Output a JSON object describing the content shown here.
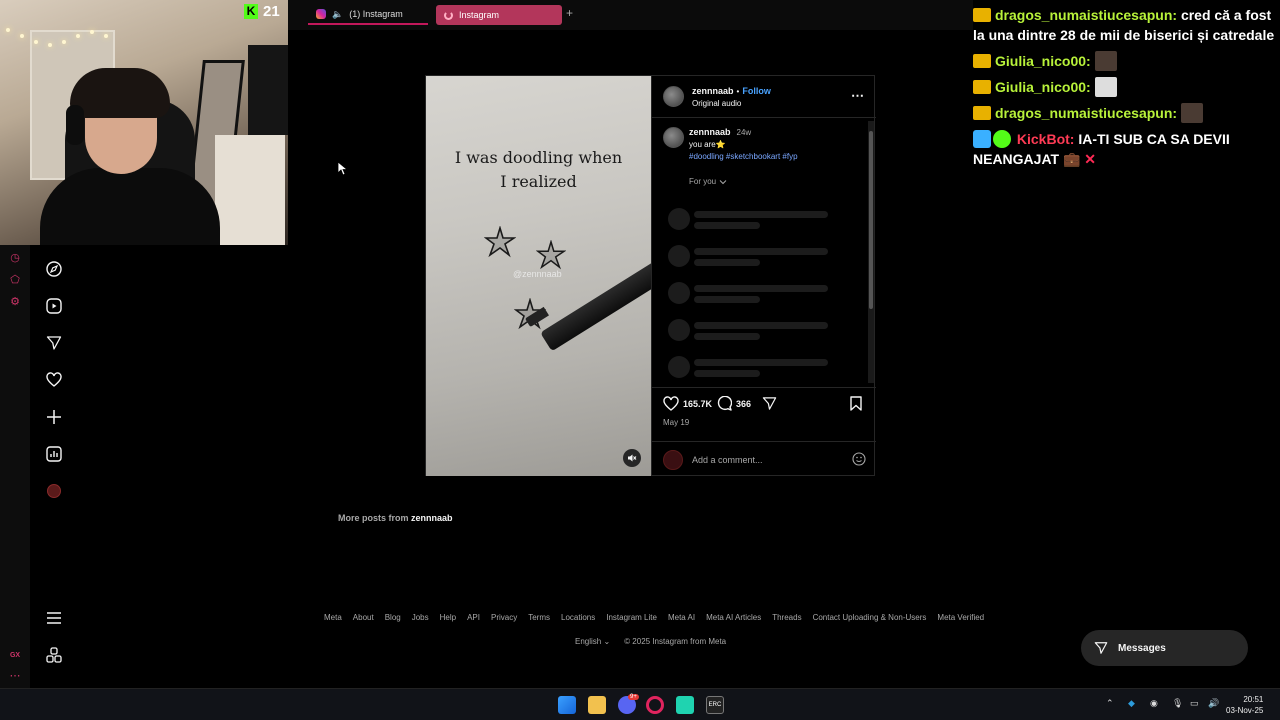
{
  "stream": {
    "kick_viewers": "21"
  },
  "browser": {
    "tabs": [
      {
        "label": "(1) Instagram"
      },
      {
        "label": "Instagram"
      }
    ],
    "new_tab": "+"
  },
  "post": {
    "author": "zennnaab",
    "follow_label": "Follow",
    "separator": "•",
    "audio": "Original audio",
    "more_label": "⋯",
    "media_text_line1": "I was doodling when",
    "media_text_line2": "I realized",
    "watermark": "@zennnaab",
    "caption": {
      "author": "zennnaab",
      "age": "24w",
      "text": "you are⭐",
      "hashtags": "#doodling #sketchbookart #fyp"
    },
    "sort_label": "For you",
    "likes": "165.7K",
    "comments": "366",
    "date": "May 19",
    "add_comment_placeholder": "Add a comment..."
  },
  "more_posts": {
    "prefix": "More posts from",
    "user": "zennnaab"
  },
  "footer": {
    "links": [
      "Meta",
      "About",
      "Blog",
      "Jobs",
      "Help",
      "API",
      "Privacy",
      "Terms",
      "Locations",
      "Instagram Lite",
      "Meta AI",
      "Meta AI Articles",
      "Threads",
      "Contact Uploading & Non-Users",
      "Meta Verified"
    ],
    "language": "English",
    "copyright": "© 2025 Instagram from Meta"
  },
  "messages_label": "Messages",
  "chat": [
    {
      "user": "dragos_numaistiucesapun:",
      "text": "cred că a fost la una dintre 28 de mii de biserici și catredale"
    },
    {
      "user": "Giulia_nico00:",
      "text": ""
    },
    {
      "user": "Giulia_nico00:",
      "text": ""
    },
    {
      "user": "dragos_numaistiucesapun:",
      "text": ""
    },
    {
      "user": "KickBot:",
      "text": "IA-TI SUB CA SA DEVII NEANGAJAT"
    }
  ],
  "taskbar": {
    "time": "20:51",
    "date": "03-Nov-25",
    "notification_badge": "9+"
  },
  "colors": {
    "accent_link": "#4aa3ff",
    "tab_active": "#b3365b",
    "kick_green": "#53fc18",
    "chat_user": "#b8f23a",
    "chat_bot": "#ff3b55"
  }
}
